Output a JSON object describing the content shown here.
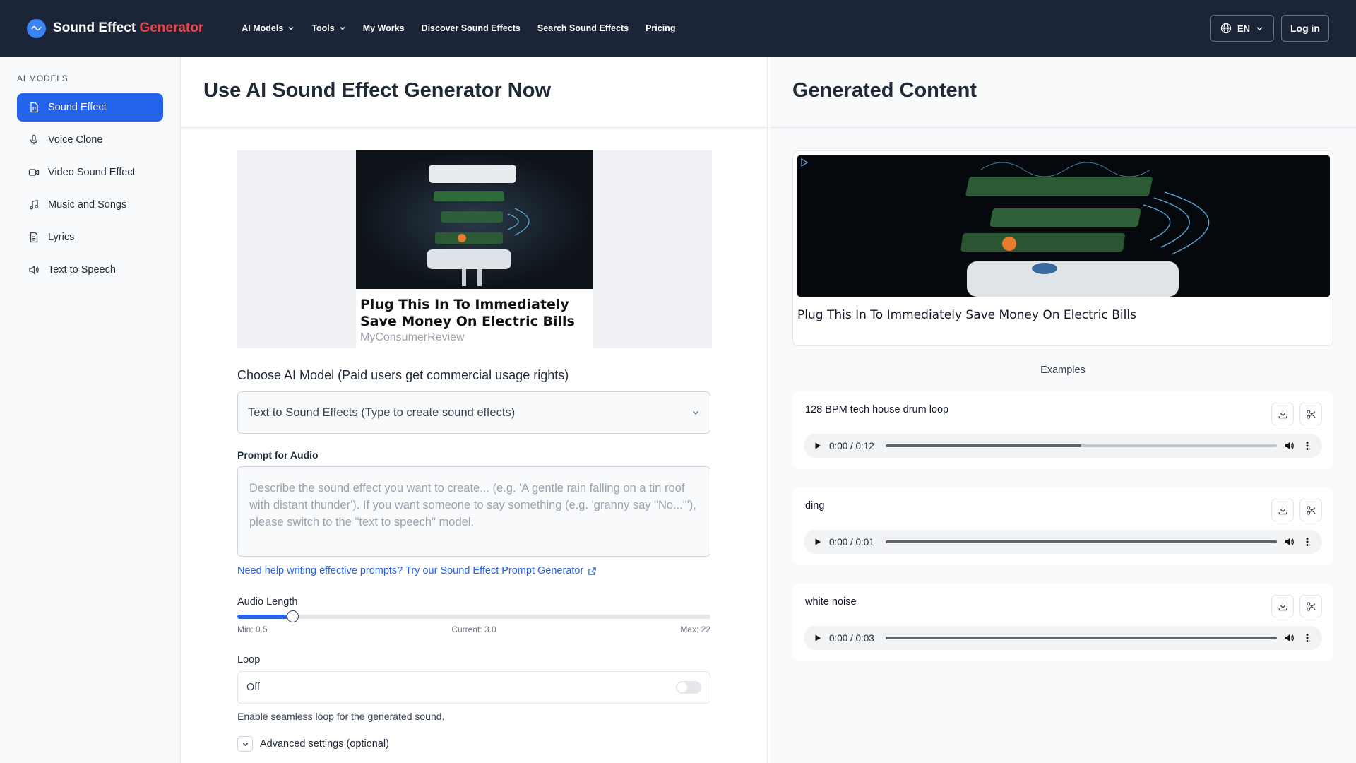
{
  "brand": {
    "name": "Sound Effect",
    "accent": "Generator"
  },
  "nav": [
    {
      "label": "AI Models",
      "dropdown": true
    },
    {
      "label": "Tools",
      "dropdown": true
    },
    {
      "label": "My Works",
      "dropdown": false
    },
    {
      "label": "Discover Sound Effects",
      "dropdown": false
    },
    {
      "label": "Search Sound Effects",
      "dropdown": false
    },
    {
      "label": "Pricing",
      "dropdown": false
    }
  ],
  "header_right": {
    "language": "EN",
    "login": "Log in"
  },
  "sidebar": {
    "heading": "AI MODELS",
    "items": [
      {
        "label": "Sound Effect",
        "icon": "sound-file-icon",
        "active": true
      },
      {
        "label": "Voice Clone",
        "icon": "microphone-icon",
        "active": false
      },
      {
        "label": "Video Sound Effect",
        "icon": "video-icon",
        "active": false
      },
      {
        "label": "Music and Songs",
        "icon": "music-note-icon",
        "active": false
      },
      {
        "label": "Lyrics",
        "icon": "document-icon",
        "active": false
      },
      {
        "label": "Text to Speech",
        "icon": "speaker-icon",
        "active": false
      }
    ]
  },
  "main": {
    "title": "Use AI Sound Effect Generator Now",
    "ad": {
      "title": "Plug This In To Immediately Save Money On Electric Bills",
      "source": "MyConsumerReview"
    },
    "model_label": "Choose AI Model (Paid users get commercial usage rights)",
    "model_selected": "Text to Sound Effects (Type to create sound effects)",
    "prompt_label": "Prompt for Audio",
    "prompt_placeholder": "Describe the sound effect you want to create... (e.g. 'A gentle rain falling on a tin roof with distant thunder'). If you want someone to say something (e.g. 'granny say \"No...\"'), please switch to the \"text to speech\" model.",
    "help_link": "Need help writing effective prompts? Try our Sound Effect Prompt Generator",
    "audio_length": {
      "label": "Audio Length",
      "min_text": "Min: 0.5",
      "current_text": "Current: 3.0",
      "max_text": "Max: 22",
      "min": 0.5,
      "max": 22,
      "value": 3.0
    },
    "loop": {
      "label": "Loop",
      "value": "Off",
      "enabled": false,
      "help": "Enable seamless loop for the generated sound."
    },
    "advanced_label": "Advanced settings (optional)"
  },
  "right": {
    "title": "Generated Content",
    "generated_caption": "Plug This In To Immediately Save Money On Electric Bills",
    "examples_title": "Examples",
    "examples": [
      {
        "title": "128 BPM tech house drum loop",
        "time": "0:00 / 0:12",
        "buffered": 0.5
      },
      {
        "title": "ding",
        "time": "0:00 / 0:01",
        "buffered": 1.0
      },
      {
        "title": "white noise",
        "time": "0:00 / 0:03",
        "buffered": 1.0
      }
    ]
  },
  "colors": {
    "topbar": "#1b2537",
    "accent": "#2563eb",
    "brand_accent": "#ef4444"
  }
}
